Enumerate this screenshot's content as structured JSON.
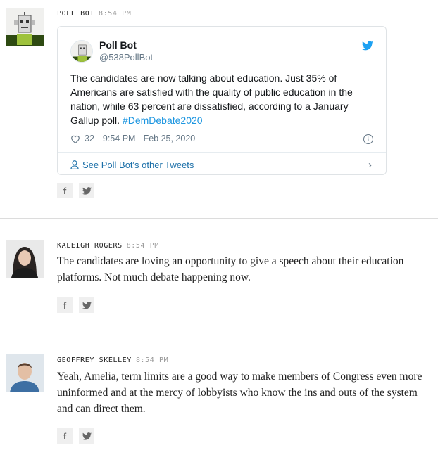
{
  "entries": [
    {
      "author": "POLL BOT",
      "time": "8:54 PM",
      "tweet": {
        "name": "Poll Bot",
        "handle": "@538PollBot",
        "text": "The candidates are now talking about education. Just 35% of Americans are satisfied with the quality of public education in the nation, while 63 percent are dissatisfied, according to a January Gallup poll.",
        "hashtag": "#DemDebate2020",
        "likes": "32",
        "timestamp": "9:54 PM - Feb 25, 2020",
        "more_label": "See Poll Bot's other Tweets"
      }
    },
    {
      "author": "KALEIGH ROGERS",
      "time": "8:54 PM",
      "text": "The candidates are loving an opportunity to give a speech about their education platforms. Not much debate happening now."
    },
    {
      "author": "GEOFFREY SKELLEY",
      "time": "8:54 PM",
      "text": "Yeah, Amelia, term limits are a good way to make members of Congress even more uninformed and at the mercy of lobbyists who know the ins and outs of the system and can direct them."
    }
  ],
  "share": {
    "facebook": "f",
    "twitter": "twitter"
  },
  "colors": {
    "twitter_blue": "#1da1f2",
    "hashtag": "#1b95e0",
    "divider": "#dcdcdc"
  },
  "icons": [
    "robot-avatar",
    "twitter-bird-icon",
    "heart-icon",
    "info-icon",
    "person-icon",
    "chevron-right-icon",
    "facebook-icon",
    "twitter-icon"
  ]
}
